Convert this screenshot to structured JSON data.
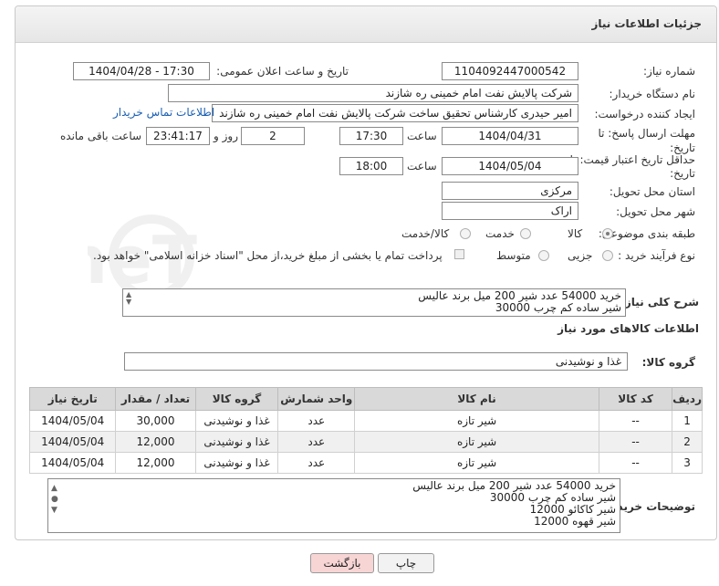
{
  "header": {
    "title": "جزئیات اطلاعات نیاز"
  },
  "form": {
    "need_number_label": "شماره نیاز:",
    "need_number": "1104092447000542",
    "announce_label": "تاریخ و ساعت اعلان عمومی:",
    "announce_value": "1404/04/28 - 17:30",
    "buyer_org_label": "نام دستگاه خریدار:",
    "buyer_org": "شرکت پالایش نفت امام خمینی  ره  شازند",
    "creator_label": "ایجاد کننده درخواست:",
    "creator": "امیر  حیدری کارشناس تحقیق ساخت شرکت پالایش نفت امام خمینی  ره  شازند",
    "contact_link": "اطلاعات تماس خریدار",
    "reply_deadline_label": "مهلت ارسال پاسخ: تا تاریخ:",
    "reply_date": "1404/04/31",
    "time_label": "ساعت",
    "reply_time": "17:30",
    "day_count": "2",
    "day_and_label": "روز و",
    "remaining_time": "23:41:17",
    "remaining_label": "ساعت باقی مانده",
    "price_deadline_label": "حداقل تاریخ اعتبار قیمت: تا تاریخ:",
    "price_date": "1404/05/04",
    "price_time": "18:00",
    "province_label": "استان محل تحویل:",
    "province": "مرکزی",
    "city_label": "شهر محل تحویل:",
    "city": "اراک",
    "category_label": "طبقه بندی موضوعی:",
    "category_options": [
      "کالا",
      "خدمت",
      "کالا/خدمت"
    ],
    "process_label": "نوع فرآیند خرید :",
    "process_options": [
      "جزیی",
      "متوسط"
    ],
    "payment_note": "پرداخت تمام یا بخشی از مبلغ خرید،از محل \"اسناد خزانه اسلامی\" خواهد بود."
  },
  "description": {
    "label": "شرح کلی نیاز:",
    "lines": [
      "خرید 54000 عدد شیر 200 میل برند عالیس",
      "شیر ساده کم چرب 30000"
    ]
  },
  "goods": {
    "section_title": "اطلاعات کالاهای مورد نیاز",
    "group_label": "گروه کالا:",
    "group_value": "غذا و نوشیدنی"
  },
  "table": {
    "headers": [
      "ردیف",
      "کد کالا",
      "نام کالا",
      "واحد شمارش",
      "گروه کالا",
      "تعداد / مقدار",
      "تاریخ نیاز"
    ],
    "rows": [
      [
        "1",
        "--",
        "شیر تازه",
        "عدد",
        "غذا و نوشیدنی",
        "30,000",
        "1404/05/04"
      ],
      [
        "2",
        "--",
        "شیر تازه",
        "عدد",
        "غذا و نوشیدنی",
        "12,000",
        "1404/05/04"
      ],
      [
        "3",
        "--",
        "شیر تازه",
        "عدد",
        "غذا و نوشیدنی",
        "12,000",
        "1404/05/04"
      ]
    ]
  },
  "buyer_notes": {
    "label": "توضیحات خریدار:",
    "lines": [
      "خرید 54000 عدد شیر 200 میل برند عالیس",
      "شیر ساده کم چرب 30000",
      "شیر کاکائو 12000",
      "شیر قهوه 12000"
    ]
  },
  "buttons": {
    "print": "چاپ",
    "back": "بازگشت"
  },
  "watermark": "AriaTender.neT",
  "colors": {
    "back_button": "#f7d5d5",
    "print_button": "#f2f2f2",
    "link": "#1a5fb4",
    "table_header": "#d9d9d9"
  }
}
